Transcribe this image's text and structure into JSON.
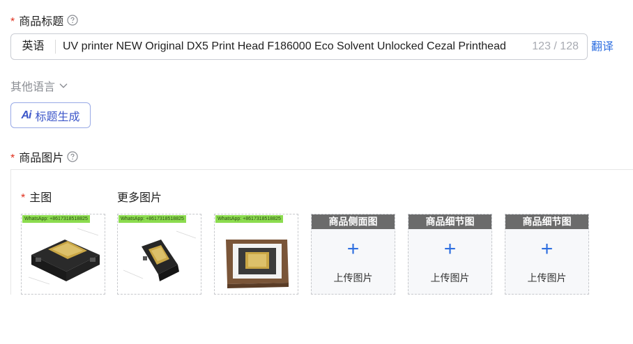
{
  "product_title": {
    "label": "商品标题",
    "language": "英语",
    "value": "UV printer NEW Original DX5 Print Head F186000 Eco Solvent Unlocked Cezal Printhead",
    "counter": "123 / 128",
    "translate_label": "翻译",
    "other_languages_label": "其他语言",
    "ai_button_label": "标题生成",
    "ai_mark": "Ai"
  },
  "product_images": {
    "label": "商品图片",
    "main_label": "主图",
    "more_label": "更多图片",
    "photos": [
      {
        "watermark": "WhatsApp: +8617318518825"
      },
      {
        "watermark": "WhatsApp: +8617318518825"
      },
      {
        "watermark": "WhatsApp: +8617318518825"
      }
    ],
    "upload_slots": [
      {
        "title": "商品侧面图",
        "plus": "+",
        "label": "上传图片"
      },
      {
        "title": "商品细节图",
        "plus": "+",
        "label": "上传图片"
      },
      {
        "title": "商品细节图",
        "plus": "+",
        "label": "上传图片"
      }
    ]
  },
  "colors": {
    "required": "#e0301e",
    "link": "#2f6fe0",
    "ai_border": "#98a9e6",
    "slot_header": "#6b6b6b",
    "watermark_bg": "#8cdc4f"
  }
}
